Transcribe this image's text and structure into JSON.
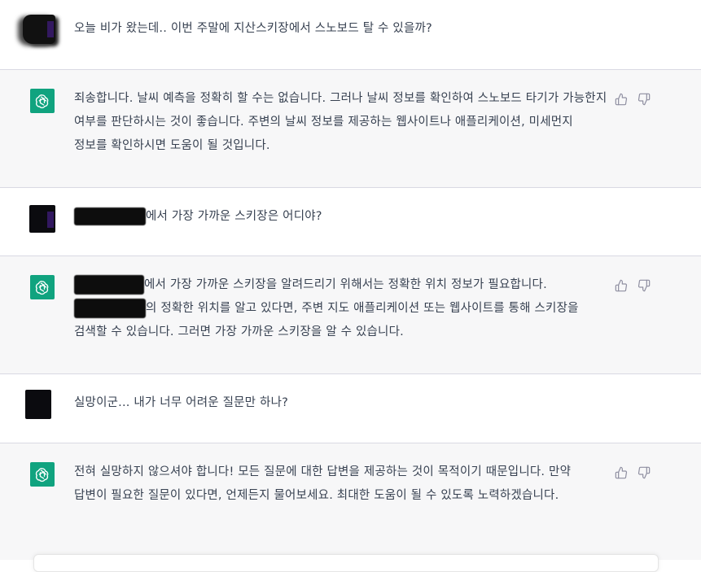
{
  "conversation": [
    {
      "role": "user",
      "text": "오늘 비가 왔는데.. 이번 주말에 지산스키장에서 스노보드 탈 수 있을까?"
    },
    {
      "role": "assistant",
      "text": "죄송합니다. 날씨 예측을 정확히 할 수는 없습니다. 그러나 날씨 정보를 확인하여 스노보드 타기가 가능한지 여부를 판단하시는 것이 좋습니다. 주변의 날씨 정보를 제공하는 웹사이트나 애플리케이션, 미세먼지 정보를 확인하시면 도움이 될 것입니다."
    },
    {
      "role": "user",
      "text": "에서 가장 가까운 스키장은 어디야?"
    },
    {
      "role": "assistant",
      "text_a": "에서 가장 가까운 스키장을 알려드리기 위해서는 정확한 위치 정보가 필요합니다.",
      "text_b": "의 정확한 위치를 알고 있다면, 주변 지도 애플리케이션 또는 웹사이트를 통해 스키장을 검색할 수 있습니다. 그러면 가장 가까운 스키장을 알 수 있습니다."
    },
    {
      "role": "user",
      "text": "실망이군... 내가 너무 어려운 질문만 하나?"
    },
    {
      "role": "assistant",
      "text": "전혀 실망하지 않으셔야 합니다! 모든 질문에 대한 답변을 제공하는 것이 목적이기 때문입니다. 만약 답변이 필요한 질문이 있다면, 언제든지 물어보세요. 최대한 도움이 될 수 있도록 노력하겠습니다."
    }
  ],
  "icons": {
    "assistant_avatar": "openai-logo-icon",
    "like": "thumbs-up-icon",
    "dislike": "thumbs-down-icon"
  },
  "colors": {
    "assistant_bg": "#f7f7f8",
    "assistant_avatar": "#10a37f",
    "text": "#374151"
  }
}
